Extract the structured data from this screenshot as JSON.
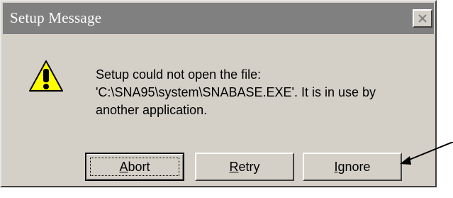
{
  "window": {
    "title": "Setup Message",
    "close_label": "×"
  },
  "dialog": {
    "icon": "warning-icon",
    "message_lines": [
      "Setup could not open the file:",
      "'C:\\SNA95\\system\\SNABASE.EXE'. It is in use by",
      "another application."
    ]
  },
  "buttons": {
    "abort": {
      "accel": "A",
      "rest": "bort"
    },
    "retry": {
      "accel": "R",
      "rest": "etry"
    },
    "ignore": {
      "accel": "I",
      "rest": "gnore"
    }
  },
  "colors": {
    "titlebar": "#808080",
    "dialog_bg": "#d4d0c8",
    "warning_yellow": "#ffff00",
    "annotation_arrow": "#000000"
  }
}
